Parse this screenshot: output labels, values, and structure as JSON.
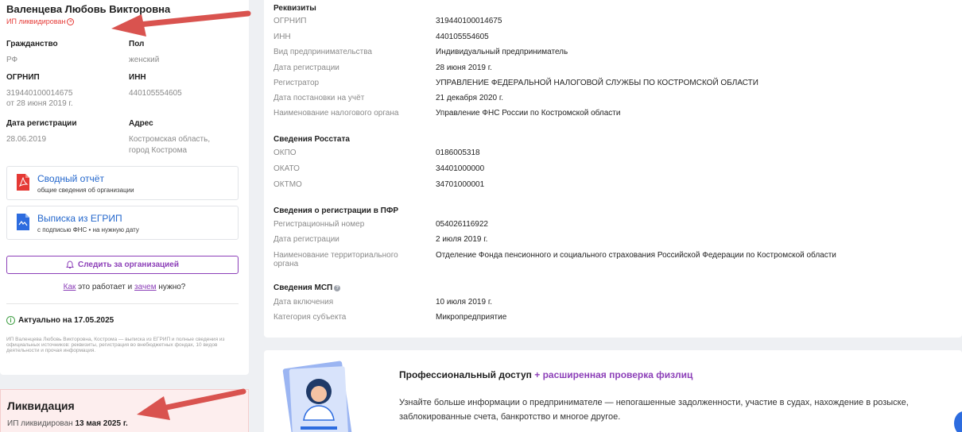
{
  "person": {
    "name": "Валенцева Любовь Викторовна",
    "status": "ИП ликвидирован"
  },
  "details": {
    "citizenship_label": "Гражданство",
    "citizenship_value": "РФ",
    "gender_label": "Пол",
    "gender_value": "женский",
    "ogrnip_label": "ОГРНИП",
    "ogrnip_value": "319440100014675",
    "ogrnip_date": "от 28 июня 2019 г.",
    "inn_label": "ИНН",
    "inn_value": "440105554605",
    "reg_date_label": "Дата регистрации",
    "reg_date_value": "28.06.2019",
    "address_label": "Адрес",
    "address_line1": "Костромская область,",
    "address_line2": "город Кострома"
  },
  "reports": [
    {
      "title": "Сводный отчёт",
      "subtitle": "общие сведения об организации",
      "icon": "pdf-icon"
    },
    {
      "title": "Выписка из ЕГРИП",
      "subtitle": "с подписью ФНС • на нужную дату",
      "icon": "doc-sign-icon"
    }
  ],
  "follow_button": "Следить за организацией",
  "howto": {
    "link1": "Как",
    "text1": " это работает и ",
    "link2": "зачем",
    "text2": " нужно?"
  },
  "actual": "Актуально на 17.05.2025",
  "description": "ИП Валенцева Любовь Викторовна, Кострома — выписка из ЕГРИП и полные сведения из официальных источников: реквизиты, регистрация во внебюджетных фондах, 10 видов деятельности и прочая информация.",
  "liquidation": {
    "title": "Ликвидация",
    "text": "ИП ликвидирован ",
    "date": "13 мая 2025 г."
  },
  "requisites": {
    "title": "Реквизиты",
    "rows": [
      {
        "label": "ОГРНИП",
        "value": "319440100014675"
      },
      {
        "label": "ИНН",
        "value": "440105554605"
      },
      {
        "label": "Вид предпринимательства",
        "value": "Индивидуальный предприниматель"
      },
      {
        "label": "Дата регистрации",
        "value": "28 июня 2019 г."
      },
      {
        "label": "Регистратор",
        "value": "УПРАВЛЕНИЕ ФЕДЕРАЛЬНОЙ НАЛОГОВОЙ СЛУЖБЫ ПО КОСТРОМСКОЙ ОБЛАСТИ"
      },
      {
        "label": "Дата постановки на учёт",
        "value": "21 декабря 2020 г."
      },
      {
        "label": "Наименование налогового органа",
        "value": "Управление ФНС России по Костромской области"
      }
    ]
  },
  "rosstat": {
    "title": "Сведения Росстата",
    "rows": [
      {
        "label": "ОКПО",
        "value": "0186005318"
      },
      {
        "label": "ОКАТО",
        "value": "34401000000"
      },
      {
        "label": "ОКТМО",
        "value": "34701000001"
      }
    ]
  },
  "pfr": {
    "title": "Сведения о регистрации в ПФР",
    "rows": [
      {
        "label": "Регистрационный номер",
        "value": "054026116922"
      },
      {
        "label": "Дата регистрации",
        "value": "2 июля 2019 г."
      },
      {
        "label": "Наименование территориального органа",
        "value": "Отделение Фонда пенсионного и социального страхования Российской Федерации по Костромской области"
      }
    ]
  },
  "msp": {
    "title": "Сведения МСП",
    "rows": [
      {
        "label": "Дата включения",
        "value": "10 июля 2019 г."
      },
      {
        "label": "Категория субъекта",
        "value": "Микропредприятие"
      }
    ]
  },
  "promo": {
    "title_main": "Профессиональный доступ",
    "title_accent": " + расширенная проверка физлиц",
    "text": "Узнайте больше информации о предпринимателе — непогашенные задолженности, участие в судах, нахождение в розыске, заблокированные счета, банкротство и многое другое."
  },
  "colors": {
    "accent": "#8c3fb8",
    "link": "#2266cc",
    "danger": "#e53935",
    "arrow": "#d9534f"
  }
}
